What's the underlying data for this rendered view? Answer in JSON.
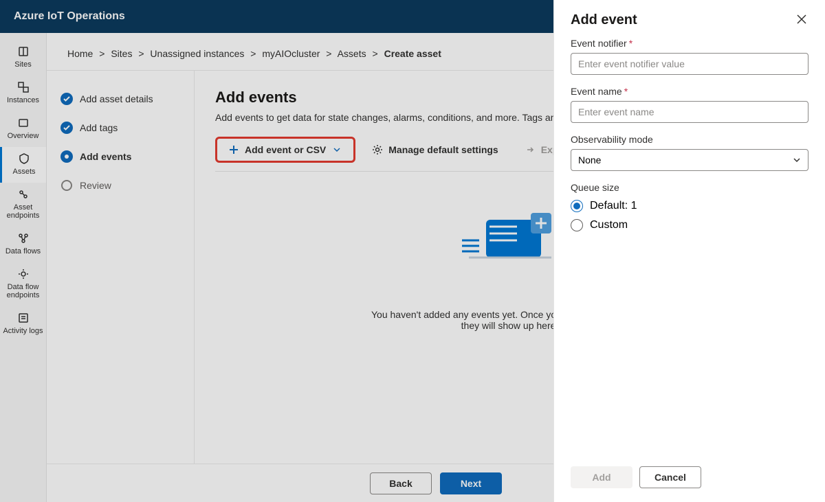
{
  "header": {
    "title": "Azure IoT Operations"
  },
  "rail": {
    "items": [
      {
        "label": "Sites",
        "icon": "sites"
      },
      {
        "label": "Instances",
        "icon": "instances"
      },
      {
        "label": "Overview",
        "icon": "overview"
      },
      {
        "label": "Assets",
        "icon": "assets"
      },
      {
        "label": "Asset endpoints",
        "icon": "asset-endpoints"
      },
      {
        "label": "Data flows",
        "icon": "dataflows"
      },
      {
        "label": "Data flow endpoints",
        "icon": "dataflow-endpoints"
      },
      {
        "label": "Activity logs",
        "icon": "activity-logs"
      }
    ],
    "selected_index": 3
  },
  "breadcrumb": {
    "items": [
      "Home",
      "Sites",
      "Unassigned instances",
      "myAIOcluster",
      "Assets",
      "Create asset"
    ]
  },
  "steps": {
    "items": [
      {
        "label": "Add asset details",
        "state": "done"
      },
      {
        "label": "Add tags",
        "state": "done"
      },
      {
        "label": "Add events",
        "state": "current"
      },
      {
        "label": "Review",
        "state": "future"
      }
    ]
  },
  "main": {
    "heading": "Add events",
    "subtext": "Add events to get data for state changes, alarms, conditions, and more. Tags and events have to be unique.",
    "toolbar": {
      "add": "Add event or CSV",
      "manage": "Manage default settings",
      "export": "Export all to CSV"
    },
    "empty_line1": "You haven't added any events yet. Once you have added events,",
    "empty_line2": "they will show up here."
  },
  "footer": {
    "back": "Back",
    "next": "Next"
  },
  "panel": {
    "title": "Add event",
    "fields": {
      "notifier_label": "Event notifier",
      "notifier_placeholder": "Enter event notifier value",
      "name_label": "Event name",
      "name_placeholder": "Enter event name",
      "obs_label": "Observability mode",
      "obs_value": "None",
      "queue_label": "Queue size",
      "queue_default": "Default: 1",
      "queue_custom": "Custom"
    },
    "buttons": {
      "add": "Add",
      "cancel": "Cancel"
    }
  }
}
